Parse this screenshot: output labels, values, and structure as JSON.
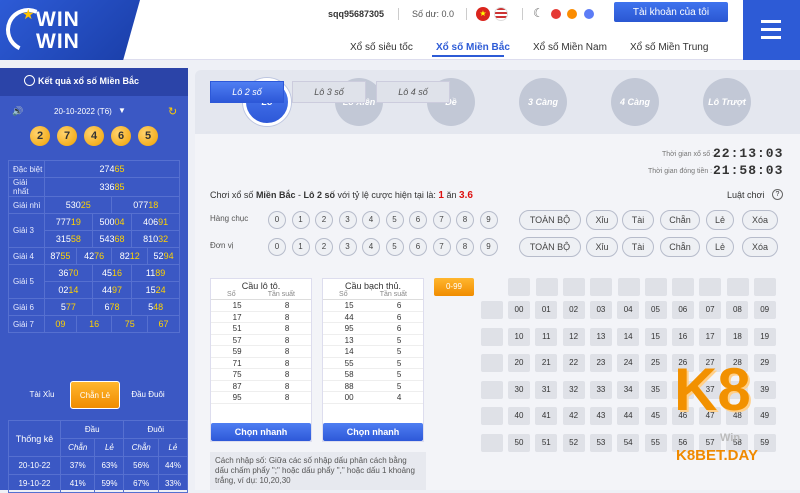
{
  "header": {
    "logo_line1": "WIN",
    "logo_line2": "WIN",
    "username": "sqq95687305",
    "balance": "Số dư: 0.0",
    "account_button": "Tài khoản của tôi",
    "nav": [
      "Xổ số siêu tốc",
      "Xổ số Miền Bắc",
      "Xổ số Miền Nam",
      "Xổ số Miền Trung"
    ],
    "nav_active": "Xổ số Miền Bắc",
    "theme_colors": [
      "#e53935",
      "#fb8c00",
      "#5c7cf6"
    ]
  },
  "left": {
    "title": "Kết quả xổ số Miền Bắc",
    "date": "20-10-2022 (T6)",
    "balls": [
      "2",
      "7",
      "4",
      "6",
      "5"
    ],
    "results": [
      {
        "label": "Đặc biệt",
        "rows": [
          [
            "274",
            "65"
          ]
        ]
      },
      {
        "label": "Giải nhất",
        "rows": [
          [
            "336",
            "85"
          ]
        ]
      },
      {
        "label": "Giải nhì",
        "rows": [
          [
            "530",
            "25"
          ],
          [
            "077",
            "18"
          ]
        ]
      },
      {
        "label": "Giải 3",
        "rows": [
          [
            "777",
            "19"
          ],
          [
            "500",
            "04"
          ],
          [
            "406",
            "91"
          ],
          [
            "315",
            "58"
          ],
          [
            "543",
            "68"
          ],
          [
            "810",
            "32"
          ]
        ]
      },
      {
        "label": "Giải 4",
        "rows": [
          [
            "87",
            "55"
          ],
          [
            "42",
            "76"
          ],
          [
            "82",
            "12"
          ],
          [
            "52",
            "94"
          ]
        ]
      },
      {
        "label": "Giải 5",
        "rows": [
          [
            "36",
            "70"
          ],
          [
            "45",
            "16"
          ],
          [
            "11",
            "89"
          ],
          [
            "02",
            "14"
          ],
          [
            "44",
            "97"
          ],
          [
            "15",
            "24"
          ]
        ]
      },
      {
        "label": "Giải 6",
        "rows": [
          [
            "5",
            "77"
          ],
          [
            "6",
            "78"
          ],
          [
            "5",
            "48"
          ]
        ]
      },
      {
        "label": "Giải 7",
        "rows": [
          [
            "",
            "09"
          ],
          [
            "",
            "16"
          ],
          [
            "",
            "75"
          ],
          [
            "",
            "67"
          ]
        ]
      }
    ],
    "tabs": [
      "Tài Xỉu",
      "Chẵn Lẻ",
      "Đầu Đuôi"
    ],
    "active_tab": "Chẵn Lẻ",
    "stats": {
      "title": "Thống kê",
      "groups": [
        "Đầu",
        "Đuôi"
      ],
      "subheaders": [
        "Chẵn",
        "Lẻ",
        "Chẵn",
        "Lẻ"
      ],
      "rows": [
        {
          "date": "20-10-22",
          "values": [
            "37%",
            "63%",
            "56%",
            "44%"
          ]
        },
        {
          "date": "19-10-22",
          "values": [
            "41%",
            "59%",
            "67%",
            "33%"
          ]
        }
      ]
    }
  },
  "bet_types": [
    "Lô",
    "Lô Xiên",
    "Đề",
    "3 Càng",
    "4 Càng",
    "Lô Trượt"
  ],
  "active_bet_type": "Lô",
  "sub_types": [
    "Lô 2 số",
    "Lô 3 số",
    "Lô 4 số"
  ],
  "active_sub_type": "Lô 2 số",
  "timers": {
    "draw_label": "Thời gian xổ số :",
    "draw_time": "22:13:03",
    "close_label": "Thời gian đóng tiền :",
    "close_time": "21:58:03"
  },
  "instruction": {
    "prefix": "Chơi xổ số",
    "region": "Miền Bắc",
    "dash": "-",
    "type": "Lô 2 số",
    "suffix": "với tỷ lệ cược hiện tại là:",
    "one": "1",
    "an": "ăn",
    "rate": "3.6"
  },
  "rules_label": "Luật chơi",
  "rules_icon": "?",
  "picker": {
    "tens_label": "Hàng chục",
    "units_label": "Đơn vị",
    "digits": [
      "0",
      "1",
      "2",
      "3",
      "4",
      "5",
      "6",
      "7",
      "8",
      "9"
    ],
    "quick": [
      "TOÀN BỘ",
      "Xỉu",
      "Tài",
      "Chẵn",
      "Lẻ",
      "Xóa"
    ]
  },
  "cau_lo_to": {
    "title": "Cầu lô tô.",
    "col1": "Số",
    "col2": "Tần suất",
    "rows": [
      [
        "15",
        "8"
      ],
      [
        "17",
        "8"
      ],
      [
        "51",
        "8"
      ],
      [
        "57",
        "8"
      ],
      [
        "59",
        "8"
      ],
      [
        "71",
        "8"
      ],
      [
        "75",
        "8"
      ],
      [
        "87",
        "8"
      ],
      [
        "95",
        "8"
      ]
    ],
    "button": "Chọn nhanh"
  },
  "cau_bach_thu": {
    "title": "Cầu bạch thủ.",
    "col1": "Số",
    "col2": "Tần suất",
    "rows": [
      [
        "15",
        "6"
      ],
      [
        "44",
        "6"
      ],
      [
        "95",
        "6"
      ],
      [
        "13",
        "5"
      ],
      [
        "14",
        "5"
      ],
      [
        "55",
        "5"
      ],
      [
        "58",
        "5"
      ],
      [
        "88",
        "5"
      ],
      [
        "00",
        "4"
      ]
    ],
    "button": "Chọn nhanh"
  },
  "manual_input": "Cách nhập số: Giữa các số nhập dấu phân cách bằng dấu chấm phẩy \";\" hoặc dấu phẩy \",\" hoặc dấu 1 khoảng trắng, ví dụ: 10,20,30",
  "range_button": "0-99",
  "number_grid": [
    "00",
    "01",
    "02",
    "03",
    "04",
    "05",
    "06",
    "07",
    "08",
    "09",
    "10",
    "11",
    "12",
    "13",
    "14",
    "15",
    "16",
    "17",
    "18",
    "19",
    "20",
    "21",
    "22",
    "23",
    "24",
    "25",
    "26",
    "27",
    "28",
    "29",
    "30",
    "31",
    "32",
    "33",
    "34",
    "35",
    "36",
    "37",
    "38",
    "39",
    "40",
    "41",
    "42",
    "43",
    "44",
    "45",
    "46",
    "47",
    "48",
    "49",
    "50",
    "51",
    "52",
    "53",
    "54",
    "55",
    "56",
    "57",
    "58",
    "59"
  ],
  "watermark": {
    "big": "K8",
    "small": "K8BET.DAY",
    "faded": "Win"
  }
}
